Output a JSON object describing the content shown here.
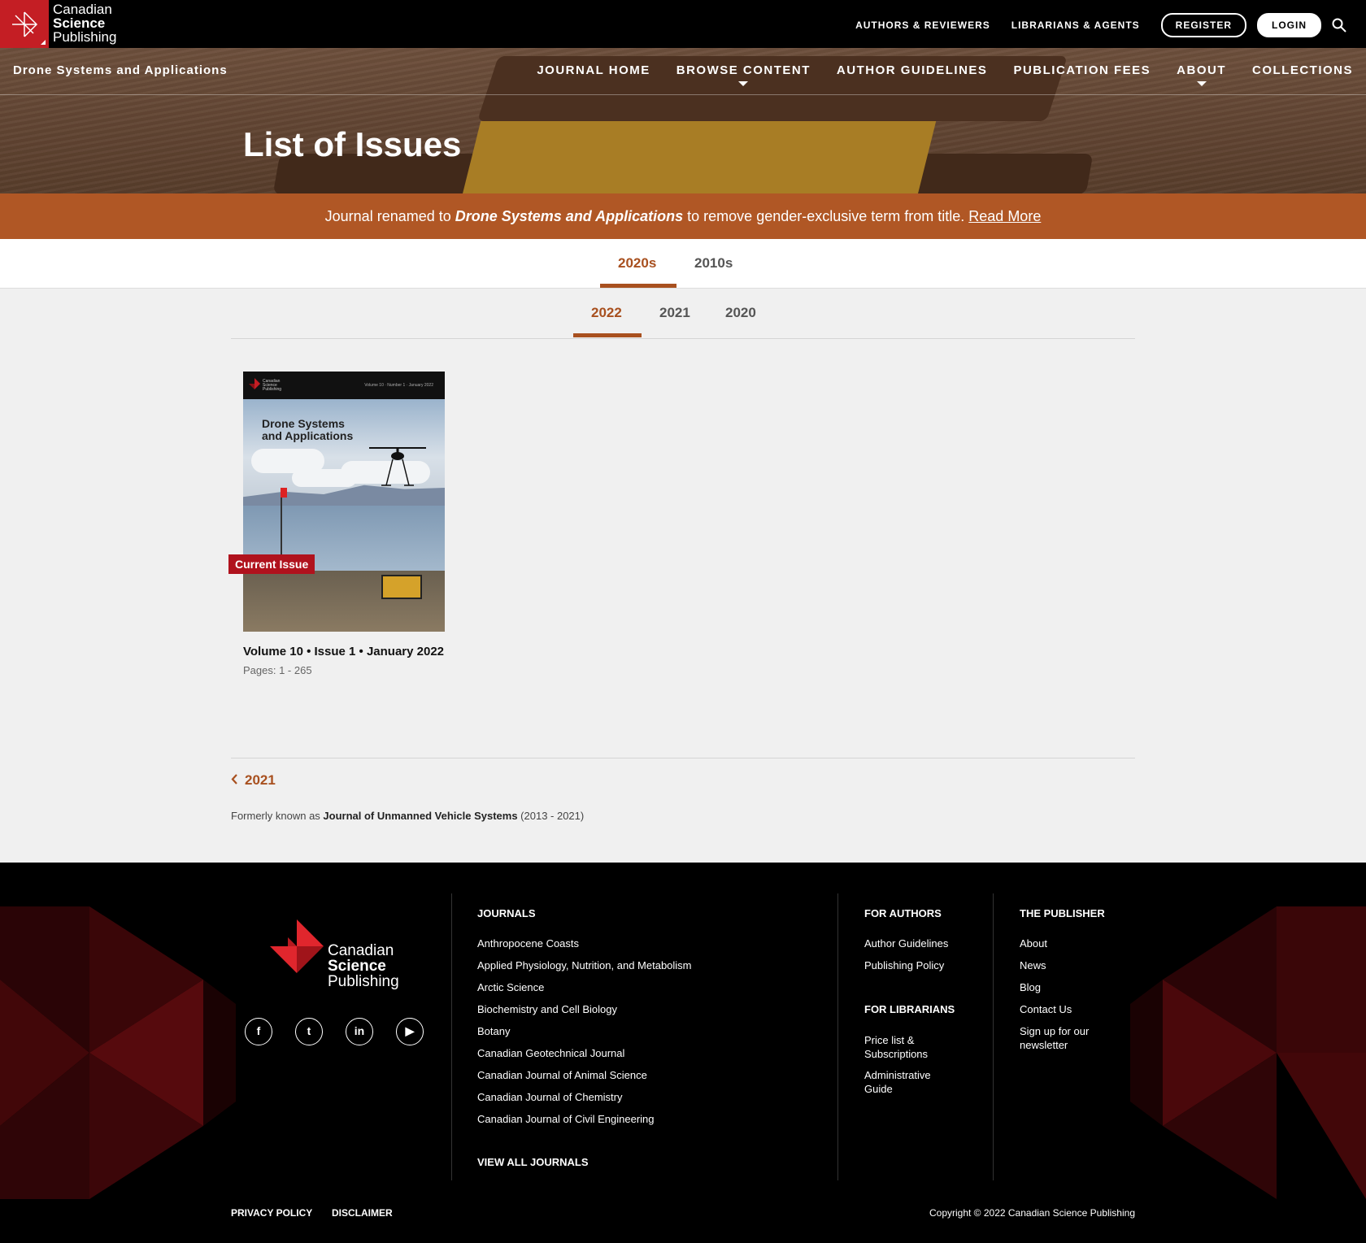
{
  "brand": {
    "line1": "Canadian",
    "line2": "Science",
    "line3": "Publishing",
    "accent_color": "#c41e24"
  },
  "topbar": {
    "links": [
      "AUTHORS & REVIEWERS",
      "LIBRARIANS & AGENTS"
    ],
    "register_label": "REGISTER",
    "login_label": "LOGIN",
    "search_icon": "search-icon"
  },
  "journal": {
    "name": "Drone Systems and Applications"
  },
  "main_nav": [
    {
      "label": "JOURNAL HOME"
    },
    {
      "label": "BROWSE CONTENT"
    },
    {
      "label": "AUTHOR GUIDELINES"
    },
    {
      "label": "PUBLICATION FEES"
    },
    {
      "label": "ABOUT"
    },
    {
      "label": "COLLECTIONS"
    }
  ],
  "page_title": "List of Issues",
  "notice": {
    "prefix": "Journal renamed to ",
    "journal": "Drone Systems and Applications",
    "suffix": " to remove gender-exclusive term from title. ",
    "link": "Read More",
    "color": "#b05725"
  },
  "decade_tabs": {
    "items": [
      "2020s",
      "2010s"
    ],
    "active": "2020s"
  },
  "year_tabs": {
    "items": [
      "2022",
      "2021",
      "2020"
    ],
    "active": "2022"
  },
  "issue": {
    "badge": "Current Issue",
    "cover_title_line1": "Drone Systems",
    "cover_title_line2": "and Applications",
    "title": "Volume 10 • Issue 1 • January 2022",
    "pages": "Pages: 1 - 265"
  },
  "prev_link": "2021",
  "formerly": {
    "prefix": "Formerly known as ",
    "name": "Journal of Unmanned Vehicle Systems",
    "suffix": " (2013 - 2021)"
  },
  "footer": {
    "brand": {
      "line1": "Canadian",
      "line2": "Science",
      "line3": "Publishing"
    },
    "social": [
      "f",
      "t",
      "in",
      "▶"
    ],
    "journals_heading": "JOURNALS",
    "journals": [
      "Anthropocene Coasts",
      "Applied Physiology, Nutrition, and Metabolism",
      "Arctic Science",
      "Biochemistry and Cell Biology",
      "Botany",
      "Canadian Geotechnical Journal",
      "Canadian Journal of Animal Science",
      "Canadian Journal of Chemistry",
      "Canadian Journal of Civil Engineering"
    ],
    "view_all": "VIEW ALL JOURNALS",
    "authors_heading": "FOR AUTHORS",
    "authors_links": [
      "Author Guidelines",
      "Publishing Policy"
    ],
    "librarians_heading": "FOR LIBRARIANS",
    "librarians_links": [
      "Price list & Subscriptions",
      "Administrative Guide"
    ],
    "publisher_heading": "THE PUBLISHER",
    "publisher_links": [
      "About",
      "News",
      "Blog",
      "Contact Us",
      "Sign up for our newsletter"
    ],
    "privacy": "PRIVACY POLICY",
    "disclaimer": "DISCLAIMER",
    "copyright": "Copyright © 2022 Canadian Science Publishing"
  }
}
